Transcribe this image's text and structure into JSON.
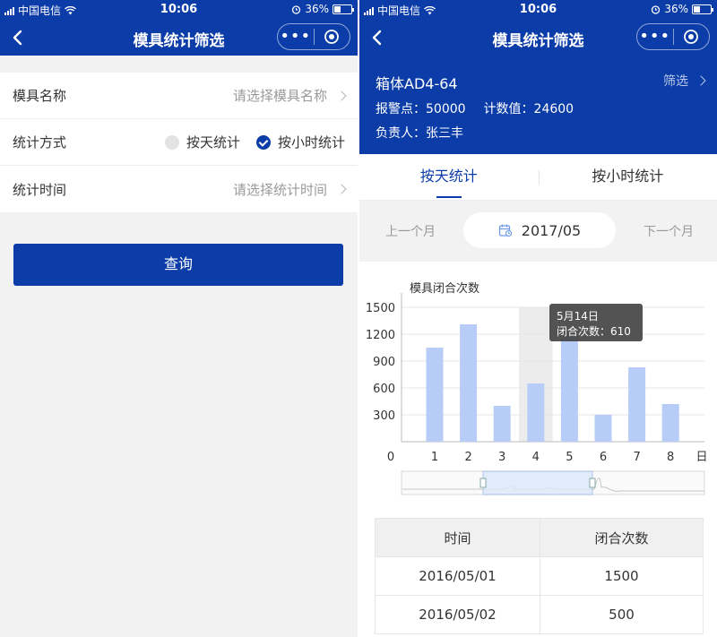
{
  "status_bar": {
    "carrier": "中国电信",
    "time": "10:06",
    "battery": "36%"
  },
  "left_screen": {
    "nav_title": "模具统计筛选",
    "form": {
      "mold_name_label": "模具名称",
      "mold_name_placeholder": "请选择模具名称",
      "stat_method_label": "统计方式",
      "option_day": "按天统计",
      "option_hour": "按小时统计",
      "selected_option": "按小时统计",
      "stat_time_label": "统计时间",
      "stat_time_placeholder": "请选择统计时间"
    },
    "query_button": "查询"
  },
  "right_screen": {
    "nav_title": "模具统计筛选",
    "info": {
      "mold_name": "箱体AD4-64",
      "filter_label": "筛选",
      "alarm_label": "报警点：50000",
      "count_label": "计数值：24600",
      "owner_label": "负责人：张三丰"
    },
    "tabs": [
      {
        "label": "按天统计",
        "active": true
      },
      {
        "label": "按小时统计",
        "active": false
      }
    ],
    "month_nav": {
      "prev": "上一个月",
      "current": "2017/05",
      "next": "下一个月"
    },
    "table": {
      "headers": [
        "时间",
        "闭合次数"
      ],
      "rows": [
        [
          "2016/05/01",
          "1500"
        ],
        [
          "2016/05/02",
          "500"
        ]
      ]
    }
  },
  "chart_data": {
    "type": "bar",
    "title": "模具闭合次数",
    "xlabel": "日",
    "ylabel": "",
    "categories": [
      "1",
      "2",
      "3",
      "4",
      "5",
      "6",
      "7",
      "8"
    ],
    "values": [
      1050,
      1310,
      400,
      650,
      1200,
      300,
      830,
      420
    ],
    "x_start_label": "0",
    "yticks": [
      1500,
      1200,
      900,
      600,
      300
    ],
    "ylim": [
      0,
      1500
    ],
    "highlighted_category": "4",
    "tooltip": {
      "title": "5月14日",
      "line": "闭合次数：610"
    },
    "bar_color": "#b7cdf7",
    "grid": true,
    "has_zoom_slider": true
  },
  "colors": {
    "primary": "#0b3ca8",
    "bar": "#b7cdf7",
    "background": "#f2f2f2"
  }
}
